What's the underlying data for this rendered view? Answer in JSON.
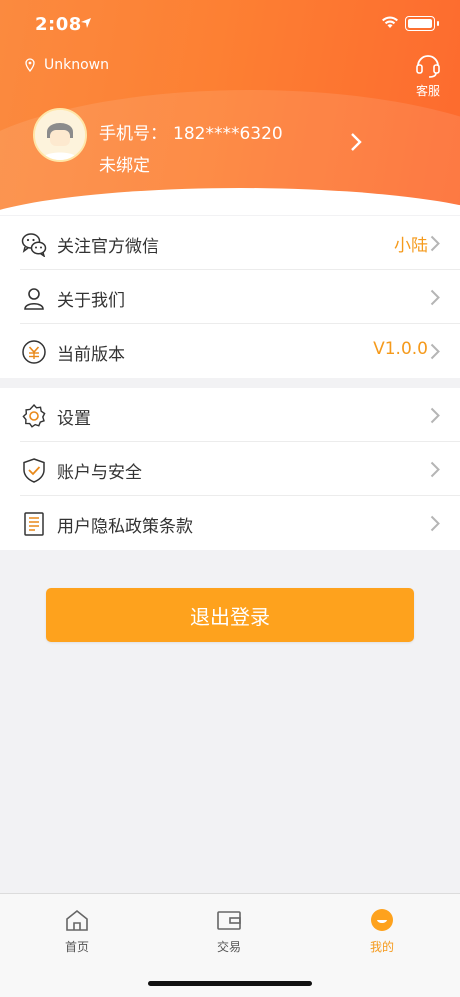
{
  "status_bar": {
    "time": "2:08"
  },
  "header": {
    "location": "Unknown",
    "service_label": "客服",
    "phone_label": "手机号：",
    "phone_value": "182****6320",
    "bind_status": "未绑定"
  },
  "menu_group_1": [
    {
      "label": "关注官方微信",
      "value": "小陆",
      "icon": "wechat-icon"
    },
    {
      "label": "关于我们",
      "value": "",
      "icon": "user-icon"
    },
    {
      "label": "当前版本",
      "value": "V1.0.0",
      "icon": "version-icon"
    }
  ],
  "menu_group_2": [
    {
      "label": "设置",
      "icon": "gear-icon"
    },
    {
      "label": "账户与安全",
      "icon": "shield-icon"
    },
    {
      "label": "用户隐私政策条款",
      "icon": "document-icon"
    }
  ],
  "logout_label": "退出登录",
  "tabbar": {
    "tabs": [
      {
        "label": "首页",
        "icon": "home-icon"
      },
      {
        "label": "交易",
        "icon": "wallet-icon"
      },
      {
        "label": "我的",
        "icon": "profile-icon",
        "active": true
      }
    ]
  },
  "colors": {
    "accent": "#fea21d",
    "header": "#fd8033",
    "value_text": "#f59a1c"
  }
}
